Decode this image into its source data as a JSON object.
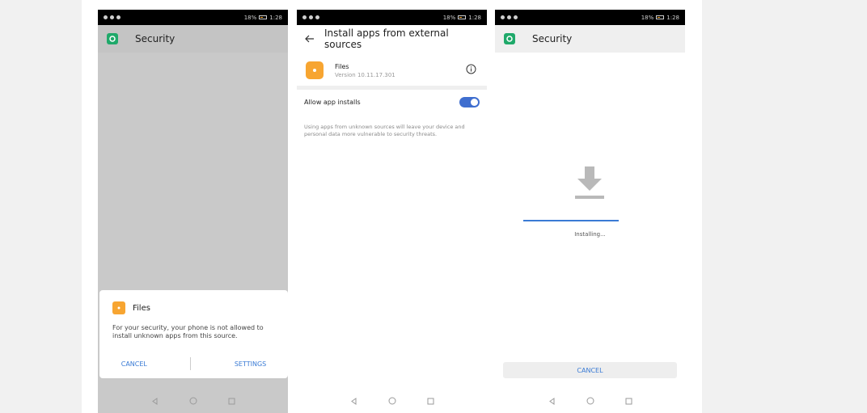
{
  "status": {
    "battery": "18%",
    "time": "1:28"
  },
  "screen1": {
    "appbar_title": "Security",
    "dialog": {
      "title": "Files",
      "message": "For your security, your phone is not allowed to install unknown apps from this source.",
      "cancel_label": "CANCEL",
      "settings_label": "SETTINGS"
    }
  },
  "screen2": {
    "appbar_title": "Install apps from external sources",
    "app_name": "Files",
    "app_version": "Version 10.11.17.301",
    "allow_label": "Allow app installs",
    "allow_enabled": true,
    "warning": "Using apps from unknown sources will leave your device and personal data more vulnerable to security threats."
  },
  "screen3": {
    "appbar_title": "Security",
    "installing_label": "Installing...",
    "cancel_label": "CANCEL"
  },
  "colors": {
    "accent": "#3a7bd5",
    "security_icon": "#1fa96a",
    "files_icon": "#f7a531",
    "toggle_on": "#3f6ecf"
  }
}
